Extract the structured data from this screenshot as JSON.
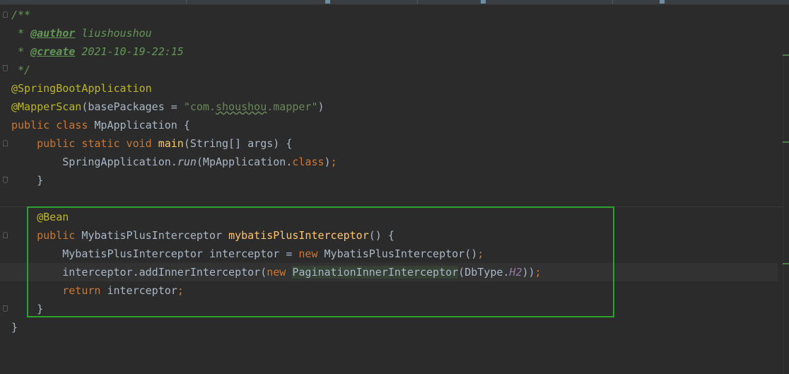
{
  "editor": {
    "language": "Java",
    "lines": [
      {
        "parts": [
          {
            "t": "/**",
            "c": "cm"
          }
        ]
      },
      {
        "parts": [
          {
            "t": " * ",
            "c": "cm"
          },
          {
            "t": "@author",
            "c": "tag"
          },
          {
            "t": " liushoushou",
            "c": "cm"
          }
        ]
      },
      {
        "parts": [
          {
            "t": " * ",
            "c": "cm"
          },
          {
            "t": "@create",
            "c": "tag"
          },
          {
            "t": " 2021-10-19-22:15",
            "c": "cm"
          }
        ]
      },
      {
        "parts": [
          {
            "t": " */",
            "c": "cm"
          }
        ]
      },
      {
        "parts": [
          {
            "t": "@SpringBootApplication",
            "c": "ann"
          }
        ]
      },
      {
        "parts": [
          {
            "t": "@MapperScan",
            "c": "ann"
          },
          {
            "t": "(basePackages = "
          },
          {
            "t": "\"com.",
            "c": "str"
          },
          {
            "t": "shoushou",
            "c": "str wavy"
          },
          {
            "t": ".mapper\"",
            "c": "str"
          },
          {
            "t": ")"
          }
        ]
      },
      {
        "parts": [
          {
            "t": "public class ",
            "c": "kw"
          },
          {
            "t": "MpApplication {"
          }
        ]
      },
      {
        "parts": [
          {
            "t": "    "
          },
          {
            "t": "public static void ",
            "c": "kw"
          },
          {
            "t": "main",
            "c": "fn"
          },
          {
            "t": "(String[] args) {"
          }
        ]
      },
      {
        "parts": [
          {
            "t": "        SpringApplication."
          },
          {
            "t": "run",
            "c": "st"
          },
          {
            "t": "(MpApplication."
          },
          {
            "t": "class",
            "c": "kw"
          },
          {
            "t": ")"
          },
          {
            "t": ";",
            "c": "kw"
          }
        ]
      },
      {
        "parts": [
          {
            "t": "    }"
          }
        ]
      },
      {
        "parts": []
      },
      {
        "parts": [
          {
            "t": "    "
          },
          {
            "t": "@Bean",
            "c": "ann"
          }
        ]
      },
      {
        "parts": [
          {
            "t": "    "
          },
          {
            "t": "public ",
            "c": "kw"
          },
          {
            "t": "MybatisPlusInterceptor "
          },
          {
            "t": "mybatisPlusInterceptor",
            "c": "fn"
          },
          {
            "t": "() {"
          }
        ]
      },
      {
        "parts": [
          {
            "t": "        MybatisPlusInterceptor interceptor = "
          },
          {
            "t": "new ",
            "c": "kw"
          },
          {
            "t": "MybatisPlusInterceptor()"
          },
          {
            "t": ";",
            "c": "kw"
          }
        ]
      },
      {
        "parts": [
          {
            "t": "        interceptor.addInnerInterceptor("
          },
          {
            "t": "new ",
            "c": "kw"
          },
          {
            "t": "PaginationInnerInterceptor",
            "c": "hl"
          },
          {
            "t": "(DbType."
          },
          {
            "t": "H2",
            "c": "field"
          },
          {
            "t": "))"
          },
          {
            "t": ";",
            "c": "kw"
          }
        ]
      },
      {
        "parts": [
          {
            "t": "        "
          },
          {
            "t": "return ",
            "c": "kw"
          },
          {
            "t": "interceptor"
          },
          {
            "t": ";",
            "c": "kw"
          }
        ]
      },
      {
        "parts": [
          {
            "t": "    }"
          }
        ]
      },
      {
        "parts": [
          {
            "t": "}"
          }
        ]
      }
    ]
  },
  "colors": {
    "background": "#2b2b2b",
    "comment": "#629755",
    "annotation": "#bbb529",
    "keyword": "#cc7832",
    "string": "#6a8759",
    "method": "#ffc66d",
    "highlight_box": "#2ea02e"
  },
  "icons": [
    "fold-icon",
    "scroll-marker-icon"
  ]
}
